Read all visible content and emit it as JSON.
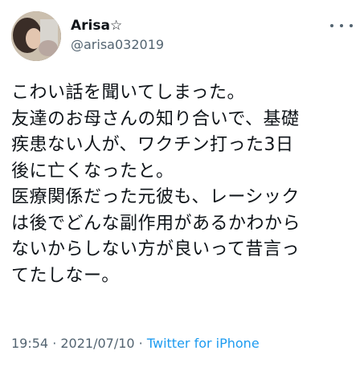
{
  "tweet": {
    "author": {
      "name": "Arisa☆",
      "handle": "@arisa032019"
    },
    "text_lines": [
      "こわい話を聞いてしまった。",
      "友達のお母さんの知り合いで、基礎",
      "疾患ない人が、ワクチン打った3日",
      "後に亡くなったと。",
      "医療関係だった元彼も、レーシック",
      "は後でどんな副作用があるかわから",
      "ないからしない方が良いって昔言っ",
      "てたしなー。"
    ],
    "time": "19:54",
    "separator": " · ",
    "date": "2021/07/10",
    "source": "Twitter for iPhone"
  },
  "colors": {
    "text": "#0f1419",
    "secondary": "#536471",
    "link": "#1d9bf0"
  },
  "icons": {
    "more": "more-options-icon"
  }
}
